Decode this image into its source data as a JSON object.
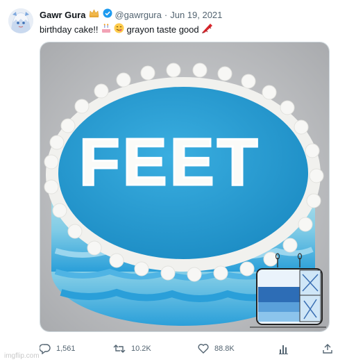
{
  "tweet": {
    "author_name": "Gawr Gura",
    "handle": "@gawrgura",
    "separator": "·",
    "date": "Jun 19, 2021",
    "text": "birthday cake!!",
    "text_tail": "grayon taste good",
    "emojis": [
      "cake-emoji",
      "yum-face-emoji",
      "red-crayon-emoji"
    ],
    "image": {
      "cake_text": "FEET",
      "subject": "blue-frosted-cake-photo",
      "sticker": "blue-cake-box-sticker"
    }
  },
  "actions": {
    "replies": "1,561",
    "retweets": "10.2K",
    "likes": "88.8K"
  },
  "watermark": "imgflip.com",
  "colors": {
    "accent": "#1d9bf0",
    "muted": "#536471",
    "cake_top": "#2d9fd4",
    "frosting": "#f4f4f2"
  }
}
